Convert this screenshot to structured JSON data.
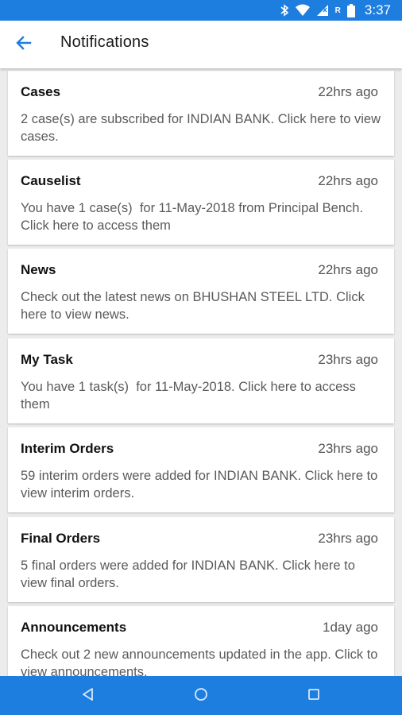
{
  "status_bar": {
    "time": "3:37",
    "icons": [
      "bluetooth-icon",
      "wifi-icon",
      "signal-icon",
      "roaming-icon",
      "battery-icon"
    ],
    "roaming_label": "R"
  },
  "app_bar": {
    "title": "Notifications",
    "back_icon": "arrow-back-icon"
  },
  "notifications": [
    {
      "title": "Cases",
      "time": "22hrs ago",
      "body": "2 case(s) are subscribed for INDIAN BANK. Click here to view cases."
    },
    {
      "title": "Causelist",
      "time": "22hrs ago",
      "body": "You have 1 case(s)  for 11-May-2018 from Principal Bench. Click here to access them"
    },
    {
      "title": "News",
      "time": "22hrs ago",
      "body": "Check out the latest news on BHUSHAN STEEL LTD. Click here to view news."
    },
    {
      "title": "My Task",
      "time": "23hrs ago",
      "body": "You have 1 task(s)  for 11-May-2018. Click here to access them"
    },
    {
      "title": "Interim Orders",
      "time": "23hrs ago",
      "body": "59 interim orders were added for INDIAN BANK. Click here to view interim orders."
    },
    {
      "title": "Final Orders",
      "time": "23hrs ago",
      "body": "5 final orders were added for INDIAN BANK. Click here to view final orders."
    },
    {
      "title": "Announcements",
      "time": "1day ago",
      "body": "Check out 2 new announcements updated in the app. Click to view announcements."
    }
  ],
  "nav_bar": {
    "icons": [
      "back-triangle-icon",
      "home-circle-icon",
      "recents-square-icon"
    ]
  },
  "colors": {
    "primary": "#1e7ee0",
    "background": "#ececec",
    "card": "#ffffff",
    "title_text": "#111111",
    "body_text": "#5a5a5a"
  }
}
